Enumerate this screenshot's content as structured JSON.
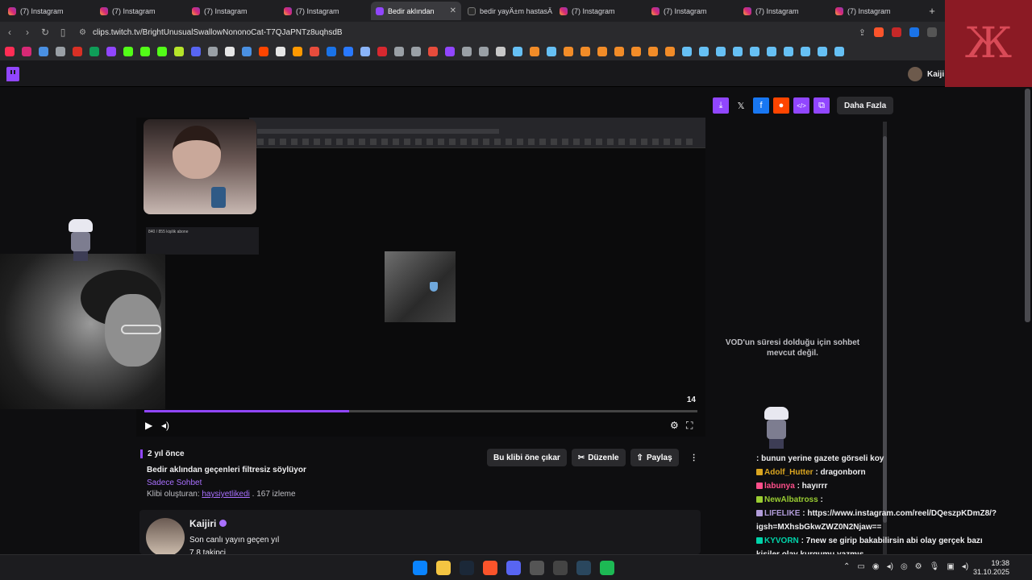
{
  "browser": {
    "tabs": [
      {
        "title": "(7) Instagram",
        "icon": "instagram-icon",
        "active": false
      },
      {
        "title": "(7) Instagram",
        "icon": "instagram-icon",
        "active": false
      },
      {
        "title": "(7) Instagram",
        "icon": "instagram-icon",
        "active": false
      },
      {
        "title": "(7) Instagram",
        "icon": "instagram-icon",
        "active": false
      },
      {
        "title": "Bedir aklından",
        "icon": "twitch-icon",
        "active": true
      },
      {
        "title": "bedir yayÄ±m hastasÄ",
        "icon": "text-icon",
        "active": false
      },
      {
        "title": "(7) Instagram",
        "icon": "instagram-icon",
        "active": false
      },
      {
        "title": "(7) Instagram",
        "icon": "instagram-icon",
        "active": false
      },
      {
        "title": "(7) Instagram",
        "icon": "instagram-icon",
        "active": false
      },
      {
        "title": "(7) Instagram",
        "icon": "instagram-icon",
        "active": false
      }
    ],
    "url": "clips.twitch.tv/BrightUnusualSwallowNononoCat-T7QJaPNTz8uqhsdB",
    "bookmark_colors": [
      "#ff2d55",
      "#d62976",
      "#4a90e2",
      "#9aa0a6",
      "#d93025",
      "#0f9d58",
      "#9146ff",
      "#53fc18",
      "#53fc18",
      "#53fc18",
      "#b6e52a",
      "#5865f2",
      "#9aa0a6",
      "#e6e6e6",
      "#4a90e2",
      "#ff4500",
      "#e6e6e6",
      "#ff9900",
      "#e74c3c",
      "#1a73e8",
      "#2979ff",
      "#8ab4f8",
      "#d7282f",
      "#9aa0a6",
      "#9aa0a6",
      "#e74c3c",
      "#9146ff",
      "#9aa0a6",
      "#9aa0a6",
      "#c8c8c8",
      "#66c0f4",
      "#f28c28",
      "#66c0f4",
      "#f28c28",
      "#f28c28",
      "#f28c28",
      "#f28c28",
      "#f28c28",
      "#f28c28",
      "#f28c28",
      "#66c0f4",
      "#66c0f4",
      "#66c0f4",
      "#66c0f4",
      "#66c0f4",
      "#66c0f4",
      "#66c0f4",
      "#66c0f4",
      "#66c0f4",
      "#66c0f4"
    ]
  },
  "twitch": {
    "username": "Kaiji",
    "share": {
      "more_label": "Daha Fazla",
      "buttons": [
        {
          "icon": "download-icon",
          "color": "#9146ff"
        },
        {
          "icon": "x-icon",
          "color": "transparent"
        },
        {
          "icon": "facebook-icon",
          "color": "#1877f2"
        },
        {
          "icon": "reddit-icon",
          "color": "#ff4500"
        },
        {
          "icon": "embed-icon",
          "color": "#9146ff"
        },
        {
          "icon": "copy-icon",
          "color": "#9146ff"
        }
      ]
    },
    "player": {
      "counter": "14",
      "progress": 0.37,
      "overlay_chat": "840 / 855 kişilik abone"
    },
    "clip": {
      "age": "2 yıl önce",
      "title": "Bedir aklından geçenleri filtresiz söylüyor",
      "category": "Sadece Sohbet",
      "created_by_label": "Klibi oluşturan:",
      "creator": "haysiyetlikedi",
      "views": ". 167 izleme"
    },
    "actions": {
      "feature": "Bu klibi öne çıkar",
      "edit": "Düzenle",
      "share": "Paylaş"
    },
    "channel": {
      "name": "Kaijiri",
      "last_live": "Son canlı yayın geçen yıl",
      "followers": "7,8 takipçi"
    },
    "chat": {
      "notice": "VOD'un süresi dolduğu için sohbet mevcut değil.",
      "messages": [
        {
          "user": "",
          "text": ": bunun yerine gazete görseli koy",
          "color": "#ff6b6b"
        },
        {
          "user": "Adolf_Hutter",
          "text": ": dragonborn",
          "color": "#daa520"
        },
        {
          "user": "labunya",
          "text": ": hayırrr",
          "color": "#ff4f8b"
        },
        {
          "user": "NewAlbatross",
          "text": ":",
          "color": "#9acd32"
        },
        {
          "user": "LIFELIKE",
          "text": ": https://www.instagram.com/reel/DQeszpKDmZ8/?igsh=MXhsbGkwZWZ0N2Njaw==",
          "color": "#b19cd9"
        },
        {
          "user": "KYVORN",
          "text": ": 7new se girip bakabilirsin abi olay gerçek bazı kişiler olay kurgumu yazmış",
          "color": "#00d4aa"
        }
      ]
    }
  },
  "taskbar": {
    "apps": [
      {
        "icon": "windows-start-icon",
        "color": "#0a84ff"
      },
      {
        "icon": "file-explorer-icon",
        "color": "#f4c542"
      },
      {
        "icon": "steam-icon",
        "color": "#1b2838"
      },
      {
        "icon": "brave-icon",
        "color": "#fb542b"
      },
      {
        "icon": "discord-icon",
        "color": "#5865f2"
      },
      {
        "icon": "app-icon",
        "color": "#555555"
      },
      {
        "icon": "chatgpt-icon",
        "color": "#444444"
      },
      {
        "icon": "steam-client-icon",
        "color": "#2a475e"
      },
      {
        "icon": "spotify-icon",
        "color": "#1db954"
      }
    ],
    "time": "19:38",
    "date": "31.10.2025"
  }
}
